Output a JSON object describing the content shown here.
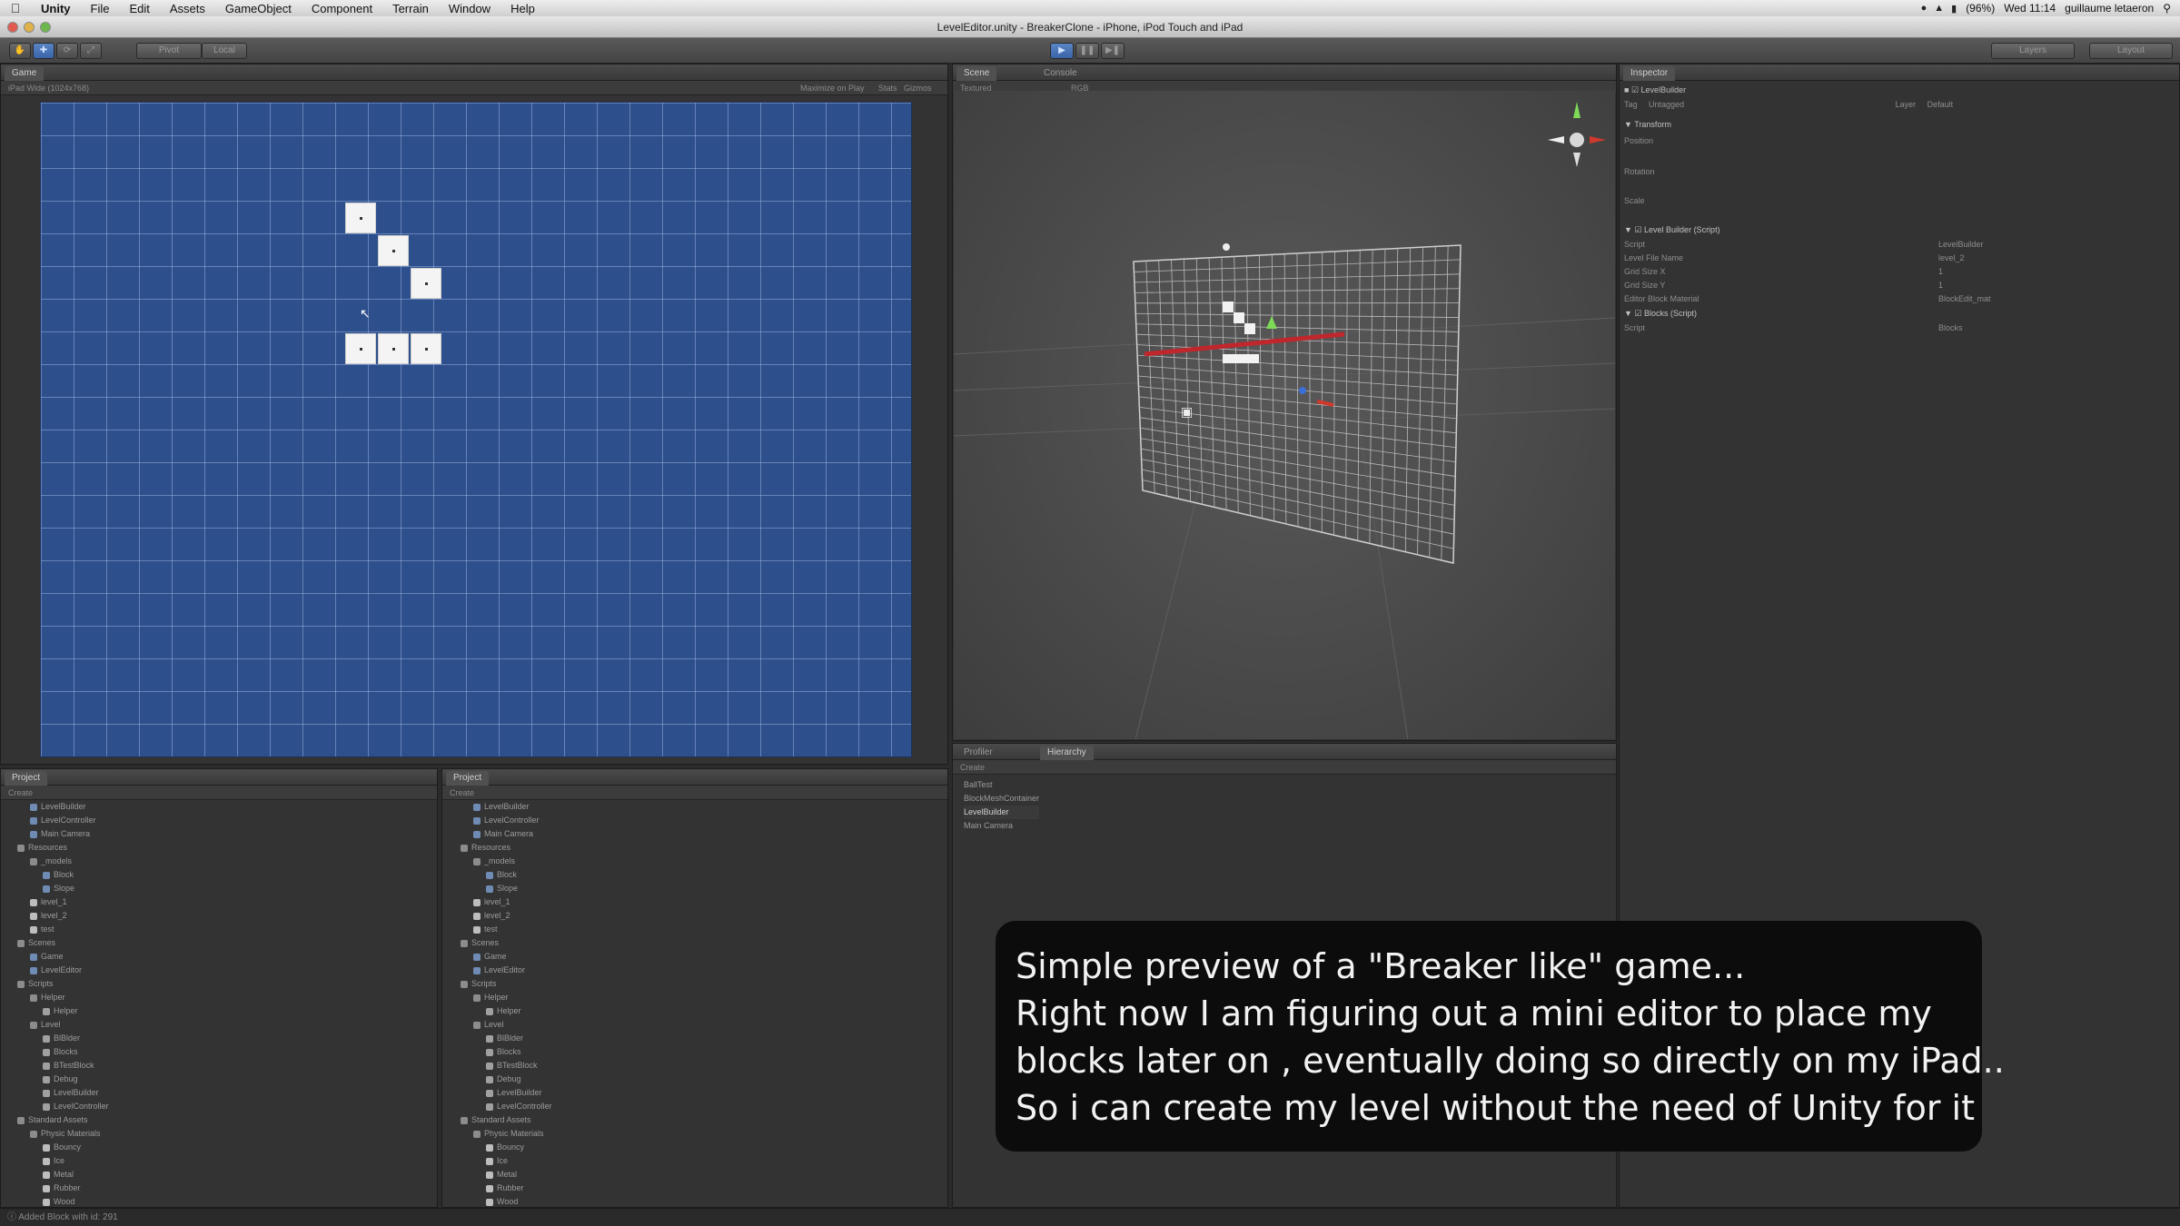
{
  "menubar": {
    "items": [
      "Unity",
      "File",
      "Edit",
      "Assets",
      "GameObject",
      "Component",
      "Terrain",
      "Window",
      "Help"
    ],
    "clock": "Wed 11:14",
    "user": "guillaume letaeron",
    "battery": "(96%)"
  },
  "window": {
    "title": "LevelEditor.unity - BreakerClone - iPhone, iPod Touch and iPad"
  },
  "toolbar": {
    "pivot_label": "Pivot",
    "local_label": "Local",
    "layers_label": "Layers",
    "layout_label": "Layout"
  },
  "game_panel": {
    "tab": "Game",
    "resolution": "iPad Wide (1024x768)",
    "maximize": "Maximize on Play",
    "stats": "Stats",
    "gizmos": "Gizmos"
  },
  "scene_panel": {
    "tab_scene": "Scene",
    "tab_console": "Console",
    "shading": "Textured",
    "render": "RGB"
  },
  "inspector": {
    "tab": "Inspector",
    "object_name": "LevelBuilder",
    "tag_label": "Tag",
    "tag_value": "Untagged",
    "layer_label": "Layer",
    "layer_value": "Default",
    "transform_label": "Transform",
    "position_label": "Position",
    "rotation_label": "Rotation",
    "scale_label": "Scale",
    "component1": "Level Builder (Script)",
    "fields": [
      {
        "label": "Script",
        "value": "LevelBuilder"
      },
      {
        "label": "Level File Name",
        "value": "level_2"
      },
      {
        "label": "Grid Size X",
        "value": "1"
      },
      {
        "label": "Grid Size Y",
        "value": "1"
      },
      {
        "label": "Editor Block Material",
        "value": "BlockEdit_mat"
      }
    ],
    "component2": "Blocks (Script)",
    "script2": {
      "label": "Script",
      "value": "Blocks"
    }
  },
  "hierarchy": {
    "tab_profiler": "Profiler",
    "tab_hierarchy": "Hierarchy",
    "create": "Create",
    "items": [
      "BallTest",
      "BlockMeshContainer",
      "LevelBuilder",
      "Main Camera"
    ]
  },
  "project_left": {
    "tab": "Project",
    "create": "Create",
    "items": [
      {
        "name": "LevelBuilder",
        "depth": 1,
        "kind": "go"
      },
      {
        "name": "LevelController",
        "depth": 1,
        "kind": "go"
      },
      {
        "name": "Main Camera",
        "depth": 1,
        "kind": "go"
      },
      {
        "name": "Resources",
        "depth": 0,
        "kind": "folder"
      },
      {
        "name": "_models",
        "depth": 1,
        "kind": "folder"
      },
      {
        "name": "Block",
        "depth": 2,
        "kind": "go"
      },
      {
        "name": "Slope",
        "depth": 2,
        "kind": "go"
      },
      {
        "name": "level_1",
        "depth": 1,
        "kind": "file"
      },
      {
        "name": "level_2",
        "depth": 1,
        "kind": "file"
      },
      {
        "name": "test",
        "depth": 1,
        "kind": "file"
      },
      {
        "name": "Scenes",
        "depth": 0,
        "kind": "folder"
      },
      {
        "name": "Game",
        "depth": 1,
        "kind": "go"
      },
      {
        "name": "LevelEditor",
        "depth": 1,
        "kind": "go"
      },
      {
        "name": "Scripts",
        "depth": 0,
        "kind": "folder"
      },
      {
        "name": "Helper",
        "depth": 1,
        "kind": "folder"
      },
      {
        "name": "Helper",
        "depth": 2,
        "kind": "script"
      },
      {
        "name": "Level",
        "depth": 1,
        "kind": "folder"
      },
      {
        "name": "BlBlder",
        "depth": 2,
        "kind": "script"
      },
      {
        "name": "Blocks",
        "depth": 2,
        "kind": "script"
      },
      {
        "name": "BTestBlock",
        "depth": 2,
        "kind": "script"
      },
      {
        "name": "Debug",
        "depth": 2,
        "kind": "script"
      },
      {
        "name": "LevelBuilder",
        "depth": 2,
        "kind": "script"
      },
      {
        "name": "LevelController",
        "depth": 2,
        "kind": "script"
      },
      {
        "name": "Standard Assets",
        "depth": 0,
        "kind": "folder"
      },
      {
        "name": "Physic Materials",
        "depth": 1,
        "kind": "folder"
      },
      {
        "name": "Bouncy",
        "depth": 2,
        "kind": "file"
      },
      {
        "name": "Ice",
        "depth": 2,
        "kind": "file"
      },
      {
        "name": "Metal",
        "depth": 2,
        "kind": "file"
      },
      {
        "name": "Rubber",
        "depth": 2,
        "kind": "file"
      },
      {
        "name": "Wood",
        "depth": 2,
        "kind": "file"
      }
    ]
  },
  "status": {
    "message": "Added Block with id: 291"
  },
  "caption": {
    "line1": "Simple preview of a \"Breaker like\" game...",
    "line2": "Right now I am figuring out a mini editor to place my",
    "line3": "blocks later on , eventually doing so directly on my iPad..",
    "line4": "So i can create my level without the need of Unity for it"
  },
  "colors": {
    "game_bg": "#2d4f8c",
    "grid_line": "#aac3eb",
    "editor_bg": "#333333",
    "selection": "#3a64a8"
  }
}
